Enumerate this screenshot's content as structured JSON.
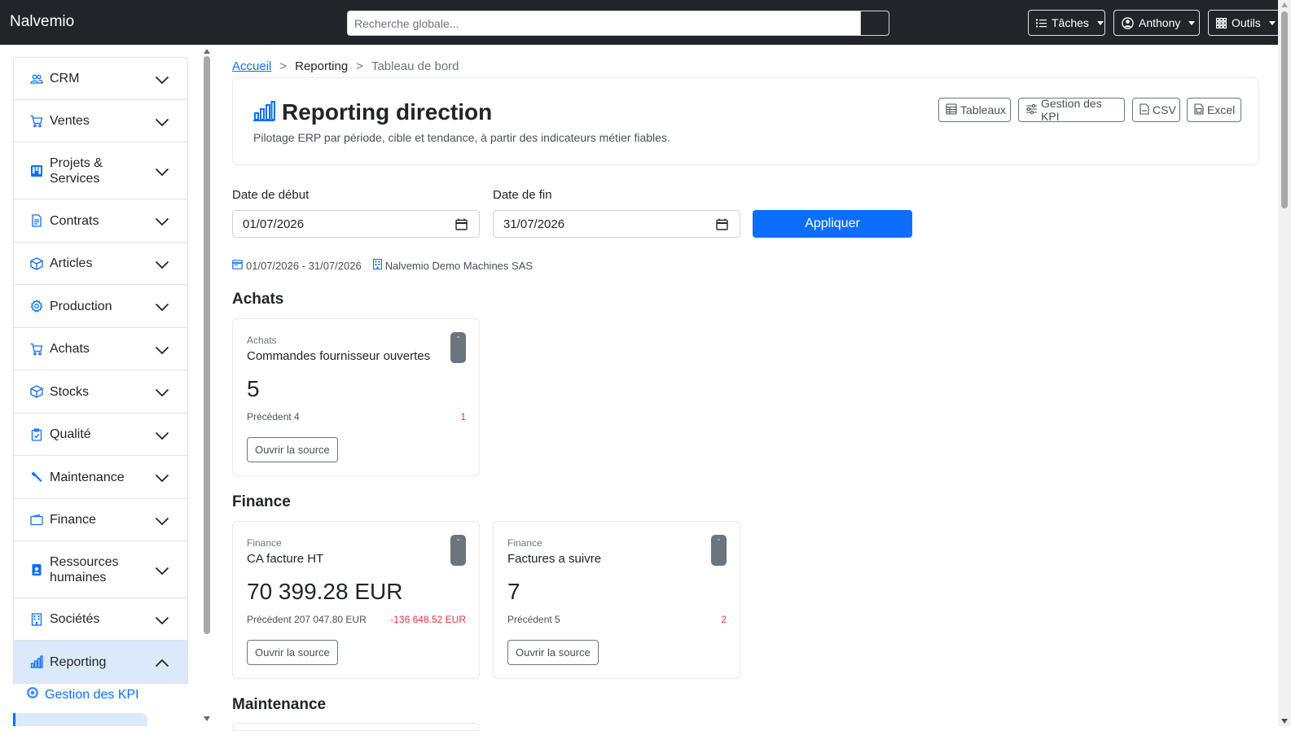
{
  "app": {
    "brand": "Nalvemio"
  },
  "search": {
    "placeholder": "Recherche globale..."
  },
  "topnav": {
    "tasks": "Tâches",
    "user": "Anthony",
    "tools": "Outils"
  },
  "sidebar": {
    "items": [
      {
        "label": "CRM",
        "icon": "users-icon"
      },
      {
        "label": "Ventes",
        "icon": "cart-icon"
      },
      {
        "label": "Projets & Services",
        "icon": "kanban-icon"
      },
      {
        "label": "Contrats",
        "icon": "document-icon"
      },
      {
        "label": "Articles",
        "icon": "box-icon"
      },
      {
        "label": "Production",
        "icon": "gear-icon"
      },
      {
        "label": "Achats",
        "icon": "cart-icon"
      },
      {
        "label": "Stocks",
        "icon": "box-icon"
      },
      {
        "label": "Qualité",
        "icon": "clipboard-check-icon"
      },
      {
        "label": "Maintenance",
        "icon": "wrench-icon"
      },
      {
        "label": "Finance",
        "icon": "wallet-icon"
      },
      {
        "label": "Ressources humaines",
        "icon": "person-badge-icon"
      },
      {
        "label": "Sociétés",
        "icon": "building-icon"
      },
      {
        "label": "Reporting",
        "icon": "bar-chart-icon"
      }
    ],
    "active": "Reporting",
    "sub_item": "Gestion des KPI"
  },
  "breadcrumb": {
    "home": "Accueil",
    "section": "Reporting",
    "current": "Tableau de bord",
    "separator": ">"
  },
  "header": {
    "title": "Reporting direction",
    "subtitle": "Pilotage ERP par période, cible et tendance, à partir des indicateurs métier fiables.",
    "buttons": {
      "boards": "Tableaux",
      "kpi": "Gestion des KPI",
      "csv": "CSV",
      "excel": "Excel"
    }
  },
  "filters": {
    "start_label": "Date de début",
    "start_value": "01/07/2026",
    "end_label": "Date de fin",
    "end_value": "31/07/2026",
    "apply": "Appliquer"
  },
  "meta": {
    "period": "01/07/2026 - 31/07/2026",
    "company": "Nalvemio Demo Machines SAS"
  },
  "sections": [
    {
      "title": "Achats",
      "cards": [
        {
          "category": "Achats",
          "name": "Commandes fournisseur ouvertes",
          "value": "5",
          "previous": "Précédent 4",
          "delta": "1",
          "badge": "-",
          "open": "Ouvrir la source"
        }
      ]
    },
    {
      "title": "Finance",
      "cards": [
        {
          "category": "Finance",
          "name": "CA facture HT",
          "value": "70 399.28 EUR",
          "previous": "Précédent 207 047.80 EUR",
          "delta": "-136 648.52 EUR",
          "badge": "-",
          "open": "Ouvrir la source"
        },
        {
          "category": "Finance",
          "name": "Factures a suivre",
          "value": "7",
          "previous": "Précédent 5",
          "delta": "2",
          "badge": "-",
          "open": "Ouvrir la source"
        }
      ]
    },
    {
      "title": "Maintenance",
      "cards": []
    }
  ],
  "colors": {
    "navbar": "#212529",
    "primary": "#0d6efd",
    "active_bg": "#dbe9fb",
    "negative": "#dc3545",
    "secondary": "#6c757d"
  }
}
